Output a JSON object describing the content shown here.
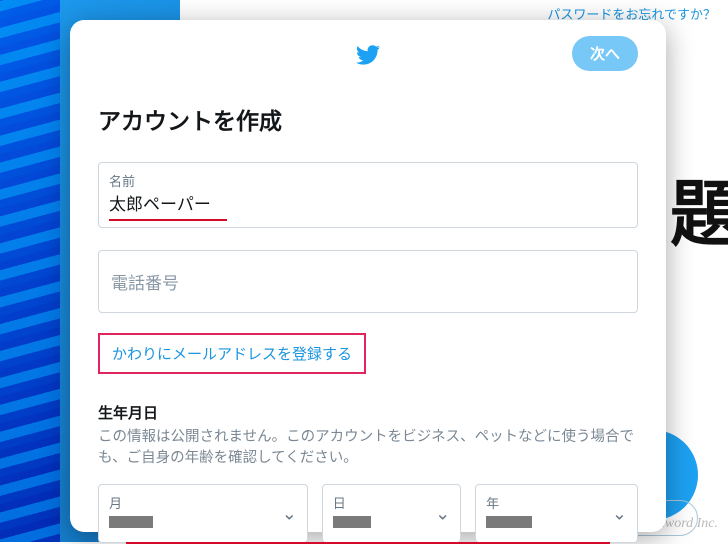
{
  "outside": {
    "forgot_password": "パスワードをお忘れですか？",
    "watermark": "Buzzword Inc.",
    "big_text_fragment": "題力"
  },
  "modal": {
    "next_button": "次へ",
    "title": "アカウントを作成",
    "name_field": {
      "label": "名前",
      "value": "太郎ペーパー"
    },
    "phone_field": {
      "placeholder": "電話番号"
    },
    "email_instead_link": "かわりにメールアドレスを登録する",
    "dob": {
      "heading": "生年月日",
      "description": "この情報は公開されません。このアカウントをビジネス、ペットなどに使う場合でも、ご自身の年齢を確認してください。",
      "month_label": "月",
      "day_label": "日",
      "year_label": "年"
    }
  }
}
